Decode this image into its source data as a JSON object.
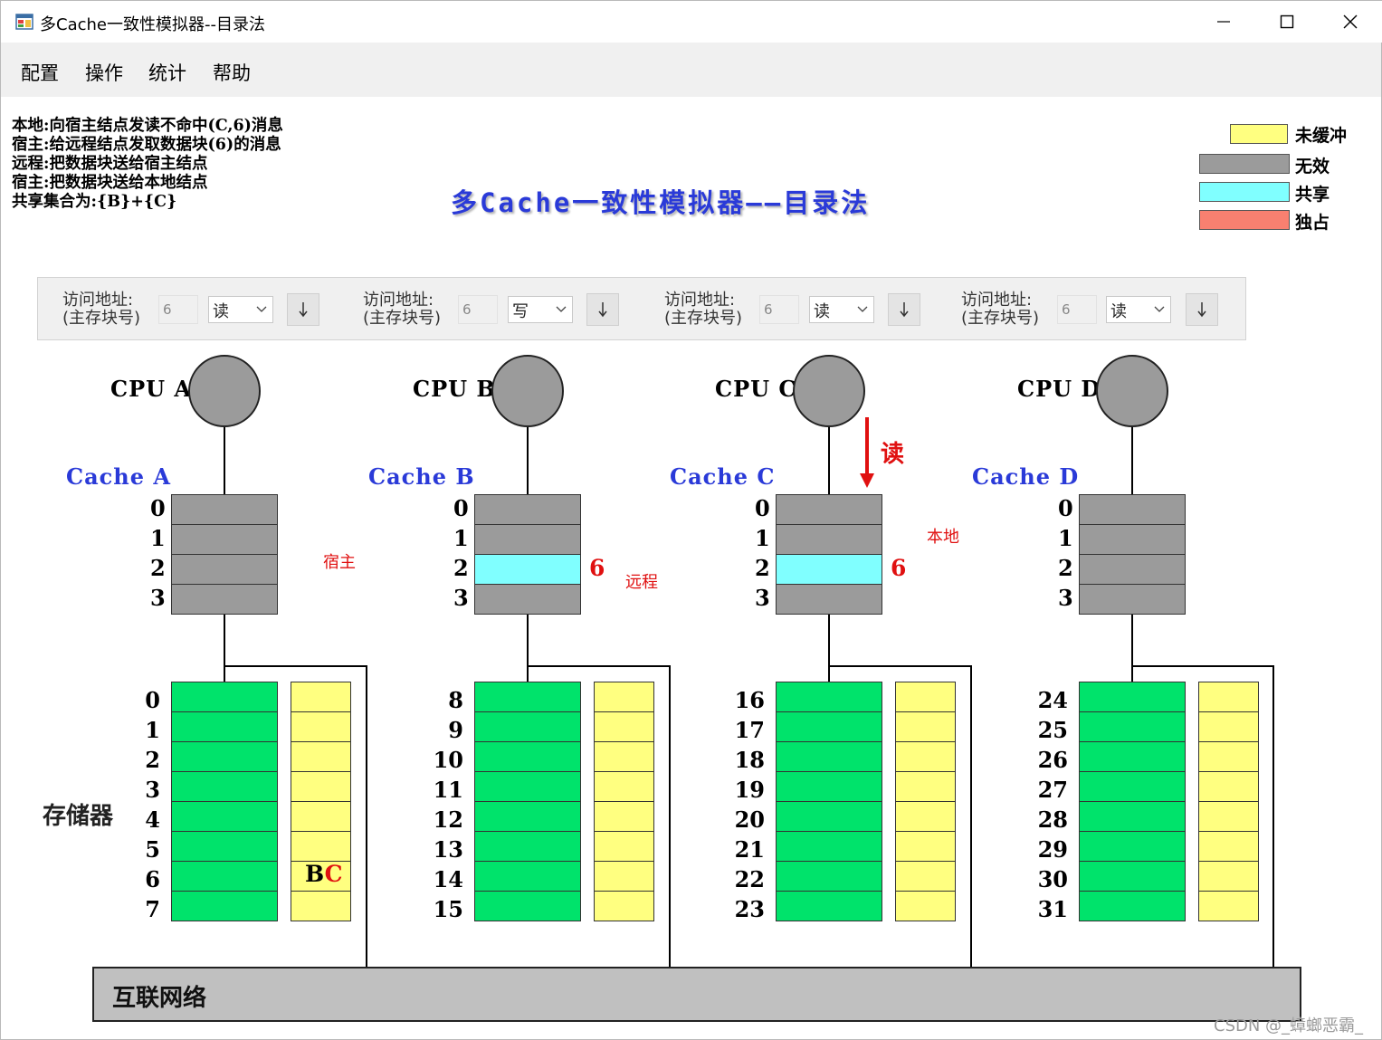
{
  "window": {
    "title": "多Cache一致性模拟器--目录法"
  },
  "menu": {
    "items": [
      "配置",
      "操作",
      "统计",
      "帮助"
    ]
  },
  "log": {
    "lines": [
      "本地:向宿主结点发读不命中(C,6)消息",
      "宿主:给远程结点发取数据块(6)的消息",
      "远程:把数据块送给宿主结点",
      "宿主:把数据块送给本地结点",
      "共享集合为:{B}+{C}"
    ]
  },
  "main_title": "多Cache一致性模拟器——目录法",
  "legend": [
    {
      "label": "未缓冲",
      "color": "#ffff80"
    },
    {
      "label": "无效",
      "color": "#9b9b9b"
    },
    {
      "label": "共享",
      "color": "#80ffff"
    },
    {
      "label": "独占",
      "color": "#f88070"
    }
  ],
  "controls": {
    "addr_label_line1": "访问地址:",
    "addr_label_line2": "(主存块号)",
    "panels": [
      {
        "cpu": "A",
        "address": "6",
        "op": "读"
      },
      {
        "cpu": "B",
        "address": "6",
        "op": "写"
      },
      {
        "cpu": "C",
        "address": "6",
        "op": "读"
      },
      {
        "cpu": "D",
        "address": "6",
        "op": "读"
      }
    ]
  },
  "nodes": [
    {
      "cpu_label": "CPU  A",
      "cache_label": "Cache  A",
      "cache_lines": [
        {
          "index": "0",
          "state": "invalid",
          "tag": ""
        },
        {
          "index": "1",
          "state": "invalid",
          "tag": ""
        },
        {
          "index": "2",
          "state": "invalid",
          "tag": ""
        },
        {
          "index": "3",
          "state": "invalid",
          "tag": ""
        }
      ],
      "role": "宿主",
      "memory_blocks": [
        "0",
        "1",
        "2",
        "3",
        "4",
        "5",
        "6",
        "7"
      ]
    },
    {
      "cpu_label": "CPU  B",
      "cache_label": "Cache  B",
      "cache_lines": [
        {
          "index": "0",
          "state": "invalid",
          "tag": ""
        },
        {
          "index": "1",
          "state": "invalid",
          "tag": ""
        },
        {
          "index": "2",
          "state": "shared",
          "tag": "6"
        },
        {
          "index": "3",
          "state": "invalid",
          "tag": ""
        }
      ],
      "role": "远程",
      "memory_blocks": [
        "8",
        "9",
        "10",
        "11",
        "12",
        "13",
        "14",
        "15"
      ]
    },
    {
      "cpu_label": "CPU  C",
      "cache_label": "Cache  C",
      "cache_lines": [
        {
          "index": "0",
          "state": "invalid",
          "tag": ""
        },
        {
          "index": "1",
          "state": "invalid",
          "tag": ""
        },
        {
          "index": "2",
          "state": "shared",
          "tag": "6"
        },
        {
          "index": "3",
          "state": "invalid",
          "tag": ""
        }
      ],
      "role": "本地",
      "memory_blocks": [
        "16",
        "17",
        "18",
        "19",
        "20",
        "21",
        "22",
        "23"
      ]
    },
    {
      "cpu_label": "CPU  D",
      "cache_label": "Cache  D",
      "cache_lines": [
        {
          "index": "0",
          "state": "invalid",
          "tag": ""
        },
        {
          "index": "1",
          "state": "invalid",
          "tag": ""
        },
        {
          "index": "2",
          "state": "invalid",
          "tag": ""
        },
        {
          "index": "3",
          "state": "invalid",
          "tag": ""
        }
      ],
      "role": "",
      "memory_blocks": [
        "24",
        "25",
        "26",
        "27",
        "28",
        "29",
        "30",
        "31"
      ]
    }
  ],
  "access_arrow_label": "读",
  "directory_entry": {
    "block": "6",
    "sharers_b": "B",
    "sharers_c": "C"
  },
  "memory_label": "存储器",
  "bus_label": "互联网络",
  "colors": {
    "invalid": "#9b9b9b",
    "shared": "#80ffff",
    "memory": "#00e36b",
    "directory": "#ffff80",
    "accent_red": "#e01010",
    "title_blue": "#2a3ad8"
  },
  "watermark": "CSDN @_蟑螂恶霸_"
}
